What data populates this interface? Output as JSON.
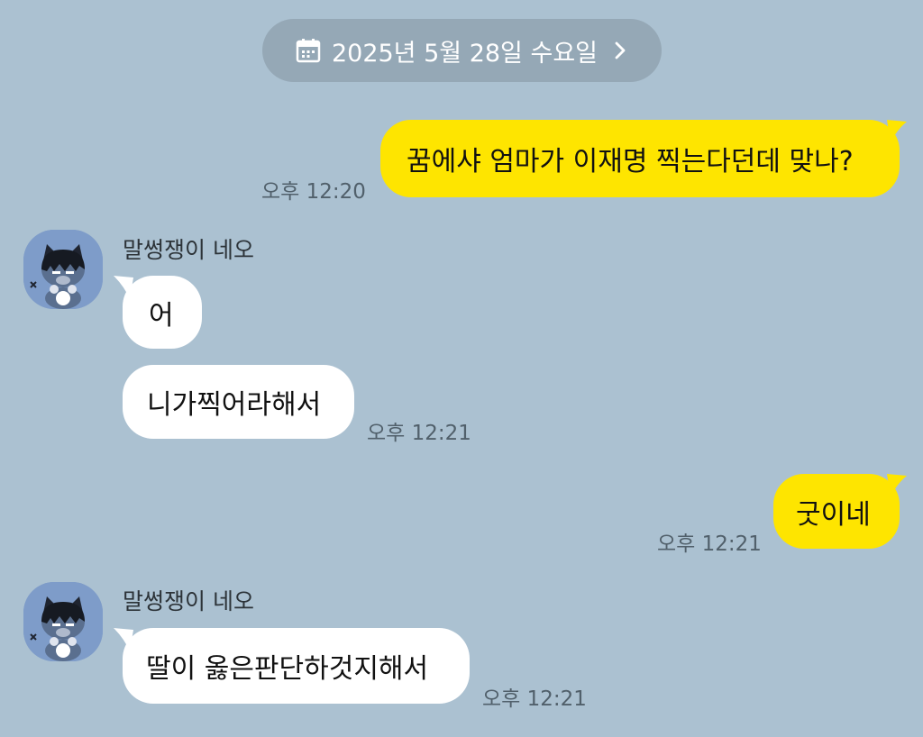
{
  "date_divider": {
    "label": "2025년 5월 28일 수요일",
    "icon": "calendar-icon",
    "chevron": "chevron-right-icon"
  },
  "colors": {
    "background": "#abc1d1",
    "my_bubble": "#fee500",
    "their_bubble": "#ffffff",
    "date_pill": "#95a8b6"
  },
  "messages": [
    {
      "sender": "me",
      "text": "꿈에샤 엄마가 이재명 찍는다던데 맞나?",
      "time": "오후 12:20"
    },
    {
      "sender_name": "말썽쟁이 네오",
      "texts": [
        "어",
        "니가찍어라해서"
      ],
      "time": "오후 12:21"
    },
    {
      "sender": "me",
      "text": "굿이네",
      "time": "오후 12:21"
    },
    {
      "sender_name": "말썽쟁이 네오",
      "texts": [
        "딸이 옳은판단하것지해서"
      ],
      "time": "오후 12:21"
    }
  ]
}
